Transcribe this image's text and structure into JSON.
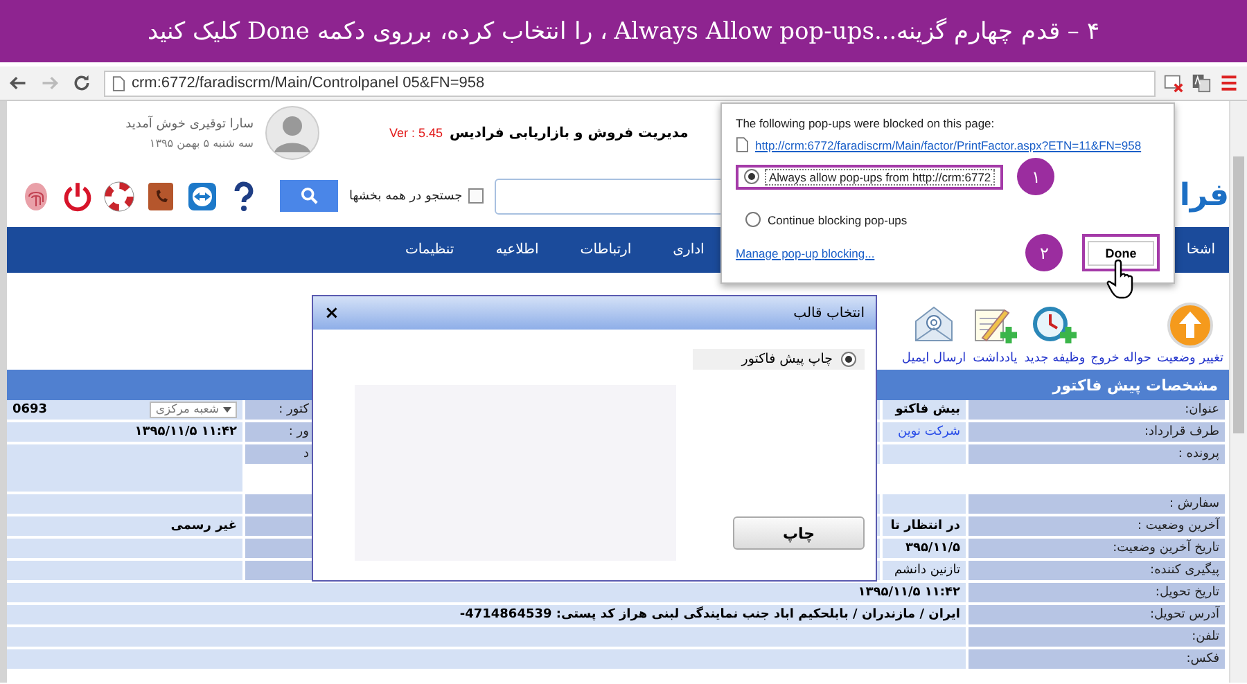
{
  "banner": {
    "text": "۴ – قدم چهارم گزینه...Always Allow pop-ups ، را انتخاب کرده، برروی دکمه  Done کلیک کنید"
  },
  "browser": {
    "url": "crm:6772/faradiscrm/Main/Controlpanel 05&FN=958"
  },
  "header": {
    "logo": "فرا",
    "title": "مدیریت فروش و بازاریابی فرادیس",
    "version": "Ver : 5.45",
    "greeting": "سارا توقیری خوش آمدید",
    "date": "سه شنبه ۵ بهمن ۱۳۹۵",
    "search_all": {
      "label": "جستجو در همه بخشها",
      "checked": false
    }
  },
  "nav": [
    {
      "label": "اشخا"
    },
    {
      "label": "اداری"
    },
    {
      "label": "ارتباطات"
    },
    {
      "label": "اطلاعیه"
    },
    {
      "label": "تنظیمات"
    }
  ],
  "toolbar": [
    {
      "label": "تغییر وضعیت",
      "kind": "arrow"
    },
    {
      "label": "حواله خروج",
      "kind": "none"
    },
    {
      "label": "وظیفه جدید",
      "kind": "clock"
    },
    {
      "label": "یادداشت",
      "kind": "note"
    },
    {
      "label": "ارسال ایمیل",
      "kind": "email"
    }
  ],
  "table": {
    "title": "مشخصات پیش فاکتور",
    "rows": [
      {
        "kind": "split",
        "label": "عنوان:",
        "value": "بیش فاکتو",
        "bold": true,
        "left_label": "کتور :",
        "left_value": "0693",
        "left_dropdown": "شعبه مرکزی"
      },
      {
        "kind": "split",
        "label": "طرف قرارداد:",
        "value": "شرکت نوین",
        "link": true,
        "left_label": "ور :",
        "left_value": "۱۱:۴۲ ۱۳۹۵/۱۱/۵"
      },
      {
        "kind": "tall",
        "label": "پرونده :",
        "left_label": "د"
      },
      {
        "kind": "split",
        "label": "سفارش :"
      },
      {
        "kind": "split",
        "label": "آخرین وضعیت :",
        "value": "در انتظار تا",
        "bold": true,
        "left_value": "غیر رسمی"
      },
      {
        "kind": "split",
        "label": "تاریخ آخرین وضعیت:",
        "value": "۳۹۵/۱۱/۵",
        "bold": true
      },
      {
        "kind": "split",
        "label": "پیگیری کننده:",
        "value": "تازنین دانشم"
      },
      {
        "kind": "full",
        "label": "تاریخ تحویل:",
        "value": "۱۱:۴۲ ۱۳۹۵/۱۱/۵",
        "bold": true
      },
      {
        "kind": "full",
        "label": "آدرس تحویل:",
        "value": "ایران / مازندران / بابلحکیم اباد جنب نمایندگی لبنی هراز کد پستی: 4714864539-",
        "bold": true
      },
      {
        "kind": "full",
        "label": "تلفن:"
      },
      {
        "kind": "full",
        "label": "فکس:"
      }
    ]
  },
  "popup": {
    "heading": "The following pop-ups were blocked on this page:",
    "link": "http://crm:6772/faradiscrm/Main/factor/PrintFactor.aspx?ETN=11&FN=958",
    "options": [
      {
        "label": "Always allow pop-ups from http://crm:6772",
        "selected": true
      },
      {
        "label": "Continue blocking pop-ups",
        "selected": false
      }
    ],
    "manage": "Manage pop-up blocking...",
    "done": "Done",
    "callouts": [
      "۱",
      "۲"
    ]
  },
  "dialog": {
    "title": "انتخاب قالب",
    "close": "×",
    "options": [
      {
        "label": "چاپ پیش فاکتور",
        "selected": true
      }
    ],
    "button": "چاپ"
  }
}
